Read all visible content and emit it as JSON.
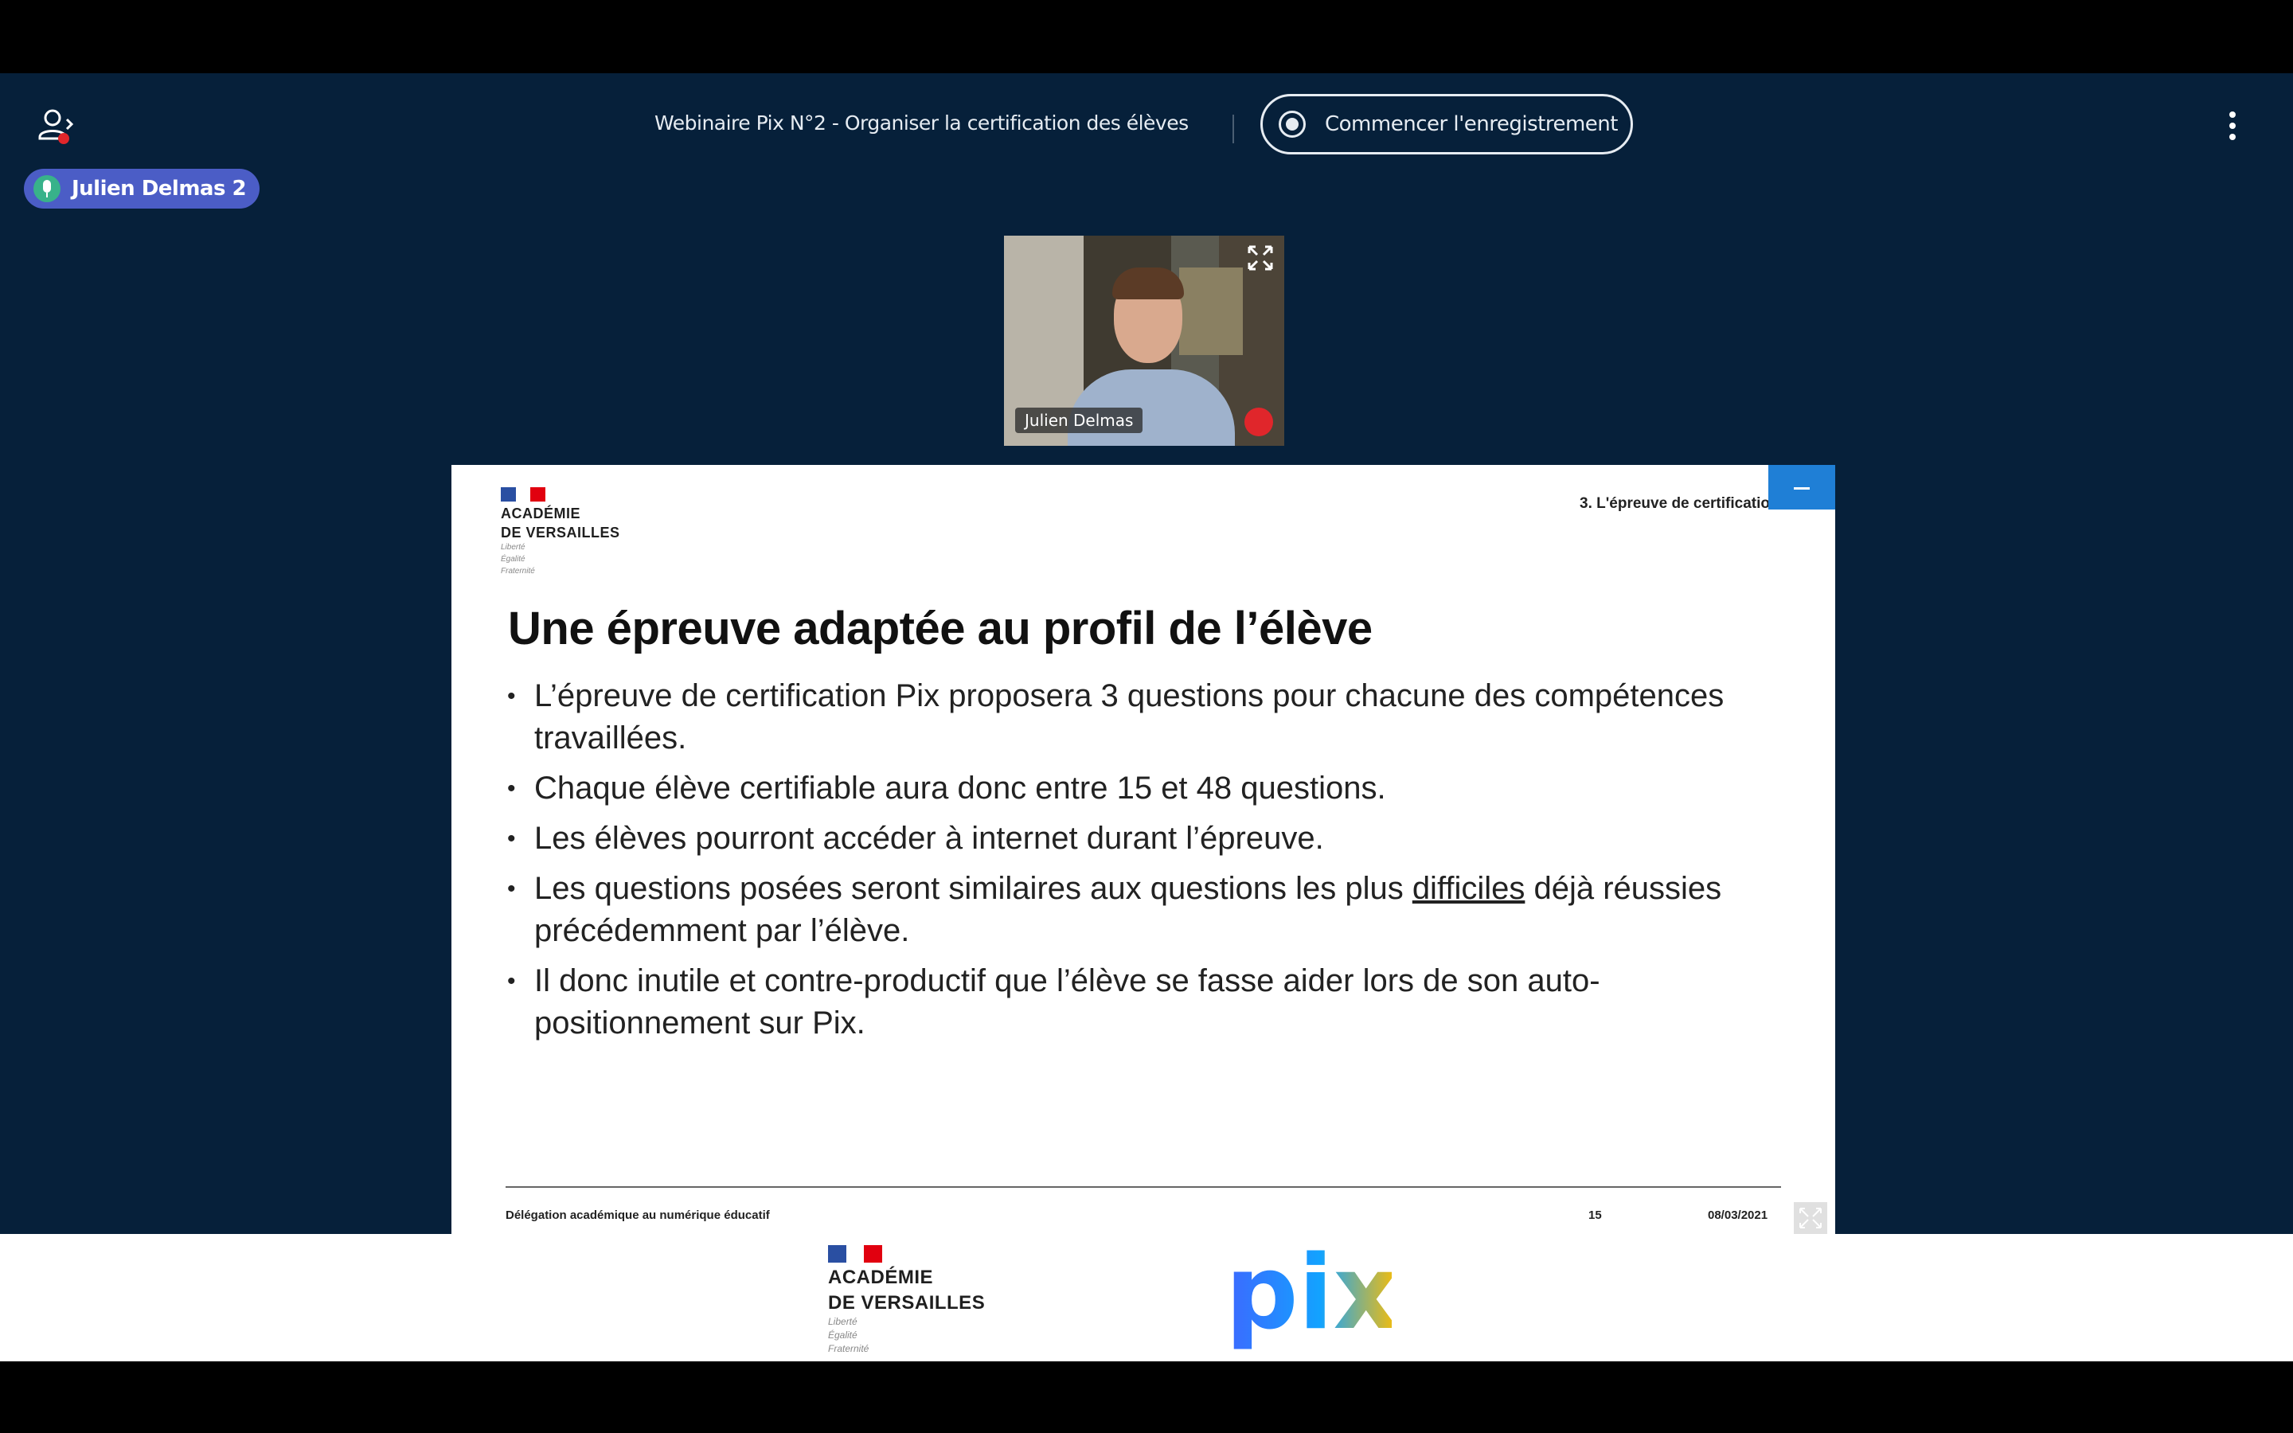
{
  "meeting": {
    "title": "Webinaire Pix N°2 - Organiser la certification des élèves",
    "record_label": "Commencer l'enregistrement",
    "active_speaker": "Julien Delmas 2"
  },
  "video": {
    "participant_name": "Julien Delmas"
  },
  "slide": {
    "logo": {
      "lines": [
        "ACADÉMIE",
        "DE VERSAILLES"
      ],
      "devise": [
        "Liberté",
        "Égalité",
        "Fraternité"
      ]
    },
    "section": "3. L'épreuve de certificatio",
    "title": "Une épreuve adaptée au profil de l’élève",
    "bullets": [
      {
        "text": "L’épreuve de certification Pix proposera 3 questions pour chacune des compétences travaillées."
      },
      {
        "text": "Chaque élève certifiable aura donc entre 15 et 48 questions."
      },
      {
        "text": "Les élèves pourront accéder à internet durant l’épreuve."
      },
      {
        "before": "Les questions posées seront similaires aux questions les plus ",
        "underlined": "difficiles",
        "after": " déjà réussies précédemment par l’élève."
      },
      {
        "text": "Il donc inutile et contre-productif que l’élève se fasse aider lors de son auto-positionnement sur Pix."
      }
    ],
    "footer": {
      "left": "Délégation académique au numérique éducatif",
      "page": "15",
      "date": "08/03/2021"
    }
  },
  "banner": {
    "logo_lines": [
      "ACADÉMIE",
      "DE VERSAILLES"
    ],
    "devise": [
      "Liberté",
      "Égalité",
      "Fraternité"
    ],
    "pix_text": "pix"
  },
  "colors": {
    "app_bg": "#06203a",
    "badge": "#4b5dc6",
    "slide_accent": "#1f7fd6",
    "pix_blue": "#3d68ff",
    "pix_yellow": "#ffbe00"
  },
  "icons": [
    "users-icon",
    "more-vertical-icon",
    "record-icon",
    "microphone-icon",
    "expand-icon",
    "fullscreen-icon"
  ]
}
